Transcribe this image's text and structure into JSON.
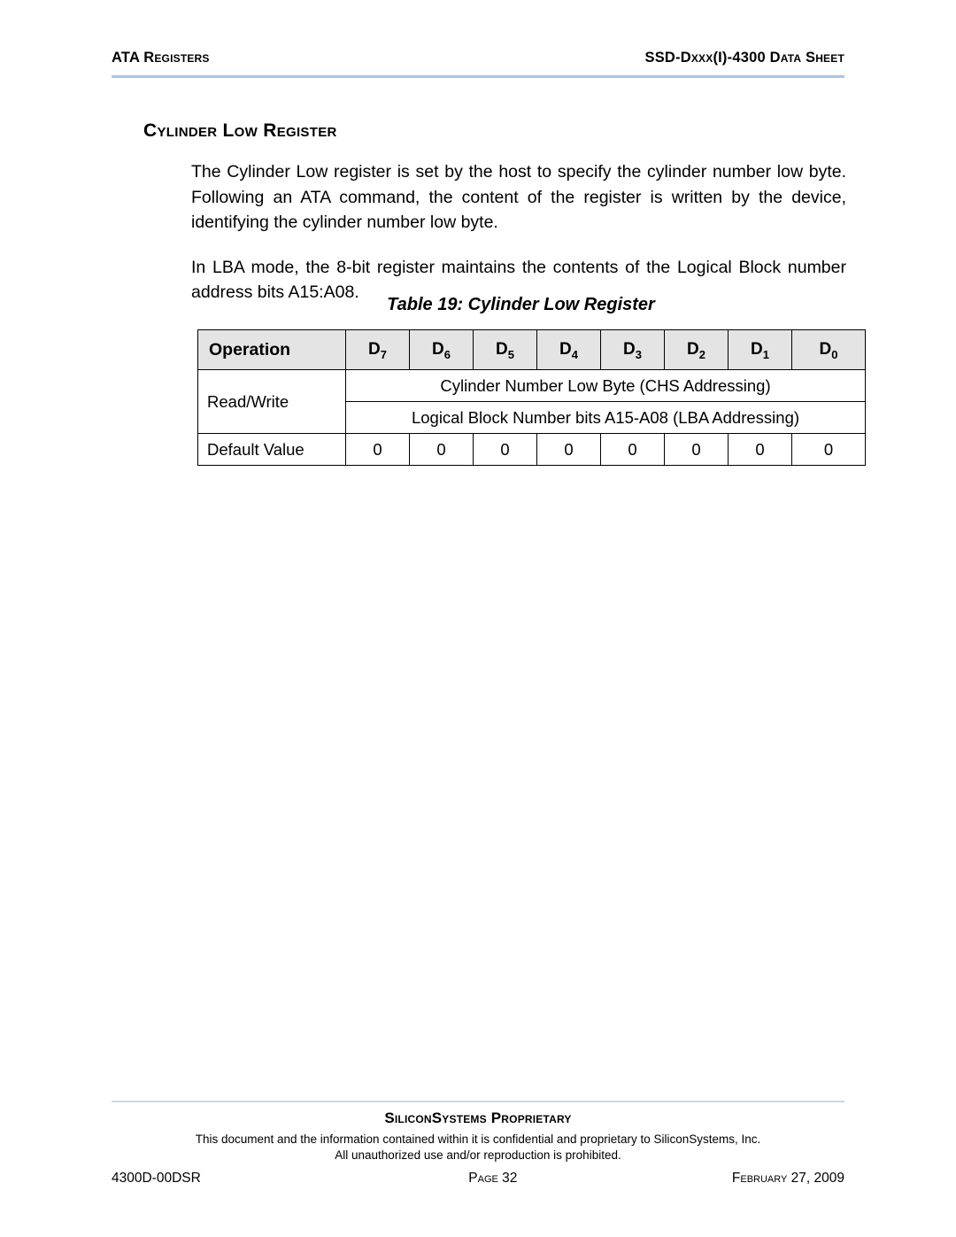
{
  "header": {
    "left": "ATA Registers",
    "right": "SSD-Dxxx(I)-4300 Data Sheet"
  },
  "section": {
    "title": "Cylinder Low Register"
  },
  "body": {
    "paragraphs": [
      "The Cylinder Low register is set by the host to specify the cylinder number low byte. Following an ATA command, the content of the register is written by the device, identifying the cylinder number low byte.",
      "In LBA mode, the 8-bit register maintains the contents of the Logical Block number address bits A15:A08."
    ]
  },
  "table": {
    "caption": "Table 19:  Cylinder Low Register",
    "columns": {
      "operation": "Operation",
      "bits": [
        {
          "letter": "D",
          "sub": "7"
        },
        {
          "letter": "D",
          "sub": "6"
        },
        {
          "letter": "D",
          "sub": "5"
        },
        {
          "letter": "D",
          "sub": "4"
        },
        {
          "letter": "D",
          "sub": "3"
        },
        {
          "letter": "D",
          "sub": "2"
        },
        {
          "letter": "D",
          "sub": "1"
        },
        {
          "letter": "D",
          "sub": "0"
        }
      ]
    },
    "rows": {
      "read_write_label": "Read/Write",
      "chs_text": "Cylinder Number Low Byte (CHS Addressing)",
      "lba_text": "Logical Block Number bits A15-A08 (LBA Addressing)",
      "default_label": "Default Value",
      "default_values": [
        "0",
        "0",
        "0",
        "0",
        "0",
        "0",
        "0",
        "0"
      ]
    }
  },
  "footer": {
    "proprietary": "SiliconSystems Proprietary",
    "confidential_line1": "This document and the information contained within it is confidential and proprietary to SiliconSystems, Inc.",
    "confidential_line2": "All unauthorized use and/or reproduction is prohibited.",
    "doc_number": "4300D-00DSR",
    "page": "Page 32",
    "date": "February 27, 2009"
  },
  "colors": {
    "header_rule": "#a8c6e6",
    "footer_rule": "#c8dce4",
    "table_header_bg": "#e4e4e4"
  }
}
